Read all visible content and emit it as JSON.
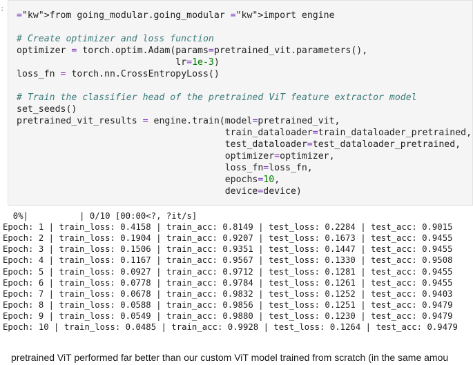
{
  "code": {
    "lines": [
      "from going_modular.going_modular import engine",
      "",
      "# Create optimizer and loss function",
      "optimizer = torch.optim.Adam(params=pretrained_vit.parameters(),",
      "                             lr=1e-3)",
      "loss_fn = torch.nn.CrossEntropyLoss()",
      "",
      "# Train the classifier head of the pretrained ViT feature extractor model",
      "set_seeds()",
      "pretrained_vit_results = engine.train(model=pretrained_vit,",
      "                                      train_dataloader=train_dataloader_pretrained,",
      "                                      test_dataloader=test_dataloader_pretrained,",
      "                                      optimizer=optimizer,",
      "                                      loss_fn=loss_fn,",
      "                                      epochs=10,",
      "                                      device=device)"
    ]
  },
  "output": {
    "progress": "  0%|          | 0/10 [00:00<?, ?it/s]",
    "epochs": [
      "Epoch: 1 | train_loss: 0.4158 | train_acc: 0.8149 | test_loss: 0.2284 | test_acc: 0.9015",
      "Epoch: 2 | train_loss: 0.1904 | train_acc: 0.9207 | test_loss: 0.1673 | test_acc: 0.9455",
      "Epoch: 3 | train_loss: 0.1506 | train_acc: 0.9351 | test_loss: 0.1447 | test_acc: 0.9455",
      "Epoch: 4 | train_loss: 0.1167 | train_acc: 0.9567 | test_loss: 0.1330 | test_acc: 0.9508",
      "Epoch: 5 | train_loss: 0.0927 | train_acc: 0.9712 | test_loss: 0.1281 | test_acc: 0.9455",
      "Epoch: 6 | train_loss: 0.0778 | train_acc: 0.9784 | test_loss: 0.1261 | test_acc: 0.9455",
      "Epoch: 7 | train_loss: 0.0678 | train_acc: 0.9832 | test_loss: 0.1252 | test_acc: 0.9403",
      "Epoch: 8 | train_loss: 0.0588 | train_acc: 0.9856 | test_loss: 0.1251 | test_acc: 0.9479",
      "Epoch: 9 | train_loss: 0.0549 | train_acc: 0.9880 | test_loss: 0.1230 | test_acc: 0.9479",
      "Epoch: 10 | train_loss: 0.0485 | train_acc: 0.9928 | test_loss: 0.1264 | test_acc: 0.9479"
    ]
  },
  "markdown": {
    "text": "pretrained ViT performed far better than our custom ViT model trained from scratch (in the same amou"
  },
  "colors": {
    "keyword": "#008000",
    "comment": "#3d7b7b",
    "cell_background": "#f5f5f5"
  }
}
